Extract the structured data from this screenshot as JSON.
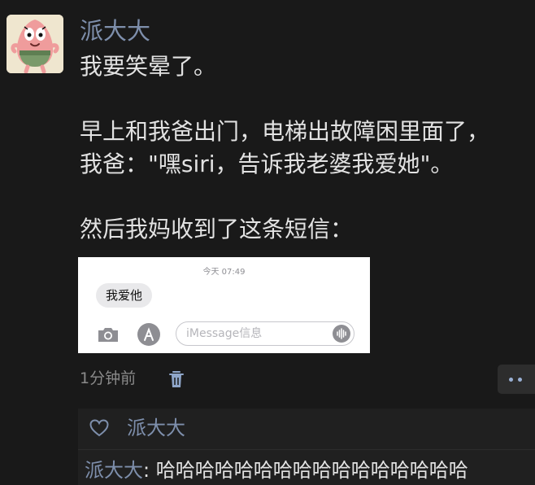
{
  "post": {
    "author": "派大大",
    "lines": [
      "我要笑晕了。",
      "早上和我爸出门，电梯出故障困里面了，",
      "我爸：\"嘿siri，告诉我老婆我爱她\"。",
      "然后我妈收到了这条短信："
    ],
    "avatar_icon": "patrick-cartoon-avatar",
    "time": "1分钟前"
  },
  "screenshot": {
    "timestamp": "今天 07:49",
    "message": "我爱他",
    "input_placeholder": "iMessage信息"
  },
  "interactions": {
    "liker": "派大大",
    "comment_author": "派大大",
    "comment_sep": ": ",
    "comment_text": "哈哈哈哈哈哈哈哈哈哈哈哈哈哈哈哈"
  },
  "colors": {
    "background": "#191919",
    "name_link": "#7e8fac",
    "body_text": "#e2e2e2",
    "meta_text": "#8a8a8a",
    "interaction_panel": "#202020"
  }
}
